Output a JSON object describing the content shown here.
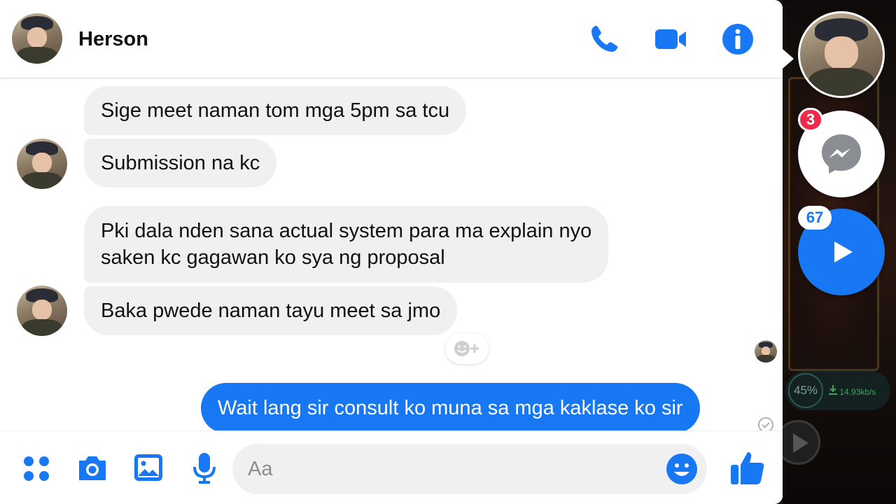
{
  "header": {
    "contact_name": "Herson"
  },
  "messages": [
    {
      "text": "Sige meet naman tom mga 5pm sa tcu",
      "direction": "incoming"
    },
    {
      "text": "Submission na kc",
      "direction": "incoming"
    },
    {
      "text_lines": [
        "Pki dala nden sana actual system para ma explain nyo",
        "saken kc gagawan ko sya ng proposal"
      ],
      "direction": "incoming"
    },
    {
      "text": "Baka pwede naman tayu meet sa jmo",
      "direction": "incoming"
    },
    {
      "text": "Wait lang sir consult ko muna sa mga kaklase ko sir",
      "direction": "outgoing"
    }
  ],
  "composer": {
    "placeholder": "Aa"
  },
  "chat_heads": {
    "messenger_badge": "3",
    "video_badge": "67"
  },
  "game_overlay": {
    "progress_text": "45%",
    "download_rate": "14.93kb/s"
  },
  "colors": {
    "accent": "#1877f2",
    "incoming_bubble": "#f0f0f0",
    "badge_red": "#f02849"
  },
  "icons": [
    "phone-icon",
    "video-camera-icon",
    "info-icon",
    "apps-icon",
    "camera-icon",
    "gallery-icon",
    "microphone-icon",
    "emoji-icon",
    "thumbs-up-icon",
    "add-reaction-icon",
    "messenger-icon",
    "play-icon",
    "delivered-check-icon"
  ]
}
